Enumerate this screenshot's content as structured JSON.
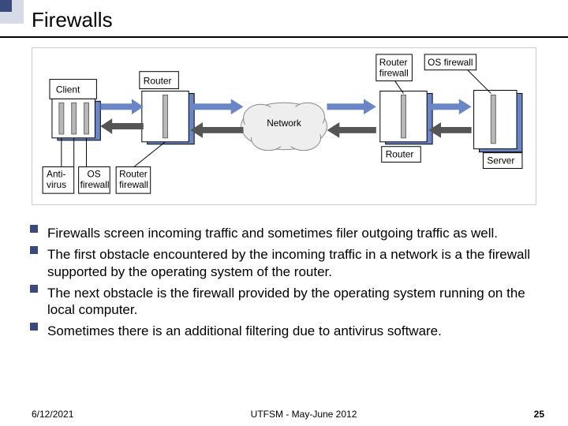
{
  "title": "Firewalls",
  "diagram": {
    "client": "Client",
    "router": "Router",
    "router2": "Router",
    "server": "Server",
    "network": "Network",
    "antivirus": "Anti-\nvirus",
    "os_firewall": "OS\nfirewall",
    "router_firewall": "Router\nfirewall",
    "top_router_fw": "Router\nfirewall",
    "top_os_fw": "OS firewall"
  },
  "bullets": [
    "Firewalls screen incoming traffic and sometimes filer outgoing traffic as well.",
    "The first obstacle encountered by the incoming traffic in a network is a the firewall supported by the operating system of the router.",
    "The next obstacle is the firewall provided by the operating system running on the local computer.",
    "Sometimes there is an additional filtering due to antivirus software."
  ],
  "footer": {
    "date": "6/12/2021",
    "center": "UTFSM - May-June 2012",
    "page": "25"
  }
}
